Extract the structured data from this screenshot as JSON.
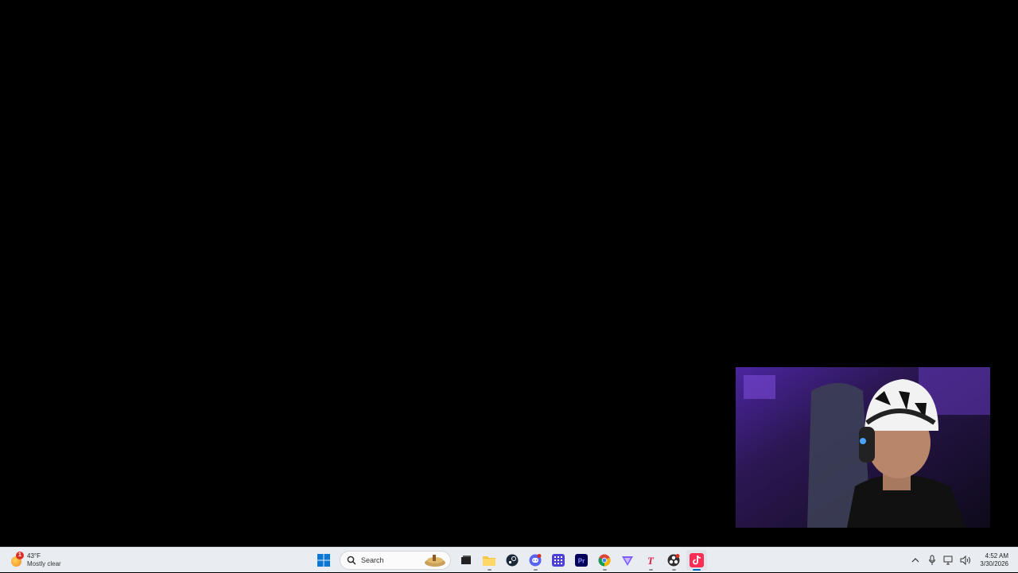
{
  "weather": {
    "temperature": "43°F",
    "condition": "Mostly clear",
    "badge": "1"
  },
  "search": {
    "label": "Search"
  },
  "taskbar_apps": [
    {
      "name": "start-button",
      "icon": "windows-icon"
    },
    {
      "name": "task-view-button",
      "icon": "task-view-icon"
    },
    {
      "name": "file-explorer-button",
      "icon": "folder-icon"
    },
    {
      "name": "steam-button",
      "icon": "steam-icon"
    },
    {
      "name": "discord-button",
      "icon": "discord-icon"
    },
    {
      "name": "grid-app-button",
      "icon": "grid-app-icon"
    },
    {
      "name": "premiere-button",
      "icon": "premiere-icon",
      "label": "Pr"
    },
    {
      "name": "chrome-button",
      "icon": "chrome-icon"
    },
    {
      "name": "vector-app-button",
      "icon": "triangle-app-icon"
    },
    {
      "name": "text-app-button",
      "icon": "t-app-icon",
      "label": "T"
    },
    {
      "name": "obs-button",
      "icon": "obs-icon"
    },
    {
      "name": "tiktok-button",
      "icon": "tiktok-icon"
    }
  ],
  "clock": {
    "time": "4:52 AM",
    "date": "3/30/2026"
  },
  "colors": {
    "taskbar_bg": "#e9edf2",
    "desktop_bg": "#000000",
    "accent": "#0067c0"
  }
}
